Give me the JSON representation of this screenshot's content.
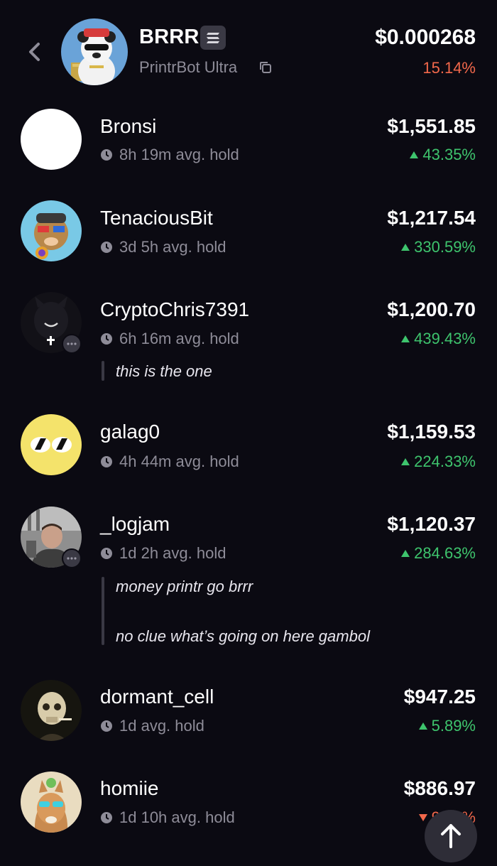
{
  "header": {
    "token_name": "BRRR",
    "subtitle": "PrintrBot Ultra",
    "price": "$0.000268",
    "change": "15.14%"
  },
  "holders": [
    {
      "name": "Bronsi",
      "hold": "8h 19m avg. hold",
      "value": "$1,551.85",
      "change": "43.35%",
      "direction": "up"
    },
    {
      "name": "TenaciousBit",
      "hold": "3d 5h avg. hold",
      "value": "$1,217.54",
      "change": "330.59%",
      "direction": "up"
    },
    {
      "name": "CryptoChris7391",
      "hold": "6h 16m avg. hold",
      "value": "$1,200.70",
      "change": "439.43%",
      "direction": "up",
      "comments": [
        "this is the one"
      ]
    },
    {
      "name": "galag0",
      "hold": "4h 44m avg. hold",
      "value": "$1,159.53",
      "change": "224.33%",
      "direction": "up"
    },
    {
      "name": "_logjam",
      "hold": "1d 2h avg. hold",
      "value": "$1,120.37",
      "change": "284.63%",
      "direction": "up",
      "comments": [
        "money printr go brrr",
        "no clue what’s going on here gambol"
      ]
    },
    {
      "name": "dormant_cell",
      "hold": "1d avg. hold",
      "value": "$947.25",
      "change": "5.89%",
      "direction": "up"
    },
    {
      "name": "homiie",
      "hold": "1d 10h avg. hold",
      "value": "$886.97",
      "change": "9.52%",
      "direction": "down"
    }
  ],
  "colors": {
    "background": "#0b0a12",
    "positive": "#3ec46d",
    "negative": "#f2684b",
    "muted": "#8e8c98"
  },
  "icons": [
    "back-chevron-icon",
    "solana-icon",
    "copy-icon",
    "clock-icon",
    "chat-icon",
    "arrow-up-icon"
  ]
}
